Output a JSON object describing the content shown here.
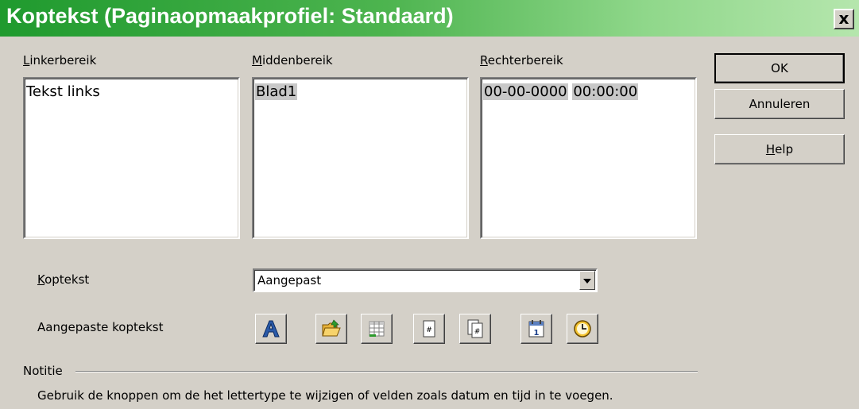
{
  "dialog": {
    "title": "Koptekst (Paginaopmaakprofiel: Standaard)",
    "close_label": "x"
  },
  "areas": {
    "left": {
      "label_key": "L",
      "label_rest": "inkerbereik",
      "content": "Tekst links"
    },
    "center": {
      "label_key": "M",
      "label_rest": "iddenbereik",
      "content": "Blad1"
    },
    "right": {
      "label_key": "R",
      "label_rest": "echterbereik",
      "date_field": "00-00-0000",
      "time_field": "00:00:00"
    }
  },
  "buttons": {
    "ok": "OK",
    "cancel": "Annuleren",
    "help_key": "H",
    "help_rest": "elp"
  },
  "header_select": {
    "label_key": "K",
    "label_rest": "optekst",
    "value": "Aangepast"
  },
  "custom_header": {
    "label": "Aangepaste koptekst",
    "icons": [
      "text-attributes-icon",
      "file-name-icon",
      "sheet-name-icon",
      "page-icon",
      "pages-icon",
      "date-icon",
      "time-icon"
    ]
  },
  "note": {
    "heading": "Notitie",
    "text": "Gebruik de knoppen om de het lettertype te wijzigen of velden zoals datum en tijd in te voegen."
  },
  "colors": {
    "titlebar_start": "#1f9a2e",
    "titlebar_end": "#b5e6ad",
    "dialog_bg": "#d4d0c8"
  }
}
